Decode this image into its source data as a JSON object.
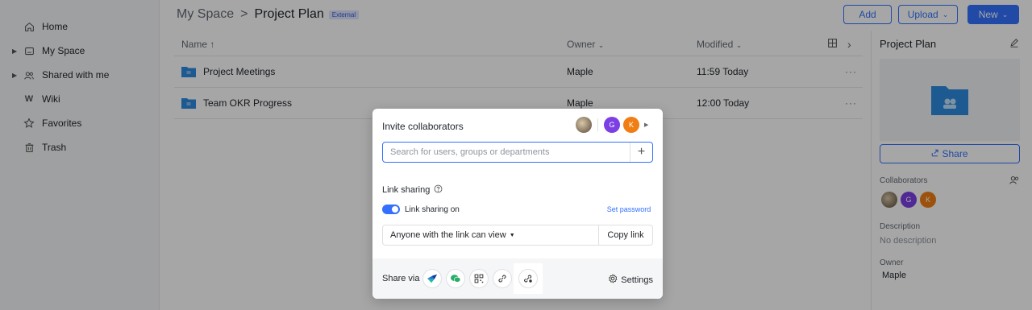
{
  "sidebar": {
    "items": [
      {
        "label": "Home",
        "icon": "home-icon"
      },
      {
        "label": "My Space",
        "icon": "drive-icon"
      },
      {
        "label": "Shared with me",
        "icon": "people-icon"
      },
      {
        "label": "Wiki",
        "icon": "wiki-icon"
      },
      {
        "label": "Favorites",
        "icon": "star-icon"
      },
      {
        "label": "Trash",
        "icon": "trash-icon"
      }
    ]
  },
  "header": {
    "root": "My Space",
    "current": "Project Plan",
    "badge": "External",
    "add_label": "Add",
    "upload_label": "Upload",
    "new_label": "New"
  },
  "table": {
    "headers": {
      "name": "Name ↑",
      "owner": "Owner",
      "modified": "Modified"
    },
    "rows": [
      {
        "name": "Project Meetings",
        "owner": "Maple",
        "modified": "11:59 Today"
      },
      {
        "name": "Team OKR Progress",
        "owner": "Maple",
        "modified": "12:00 Today"
      }
    ]
  },
  "panel": {
    "title": "Project Plan",
    "share_label": "Share",
    "collaborators_label": "Collaborators",
    "description_label": "Description",
    "description_value": "No description",
    "owner_label": "Owner",
    "owner_value": "Maple",
    "avatars": [
      "",
      "G",
      "K"
    ]
  },
  "modal": {
    "title": "Invite collaborators",
    "avatars": [
      "",
      "G",
      "K"
    ],
    "search_placeholder": "Search for users, groups or departments",
    "link_sharing_label": "Link sharing",
    "toggle_label": "Link sharing on",
    "set_password": "Set password",
    "permission": "Anyone with the link can view",
    "copy_link": "Copy link",
    "share_via": "Share via",
    "settings": "Settings"
  },
  "colors": {
    "accent": "#3370ff",
    "folder": "#2d8ae0"
  }
}
